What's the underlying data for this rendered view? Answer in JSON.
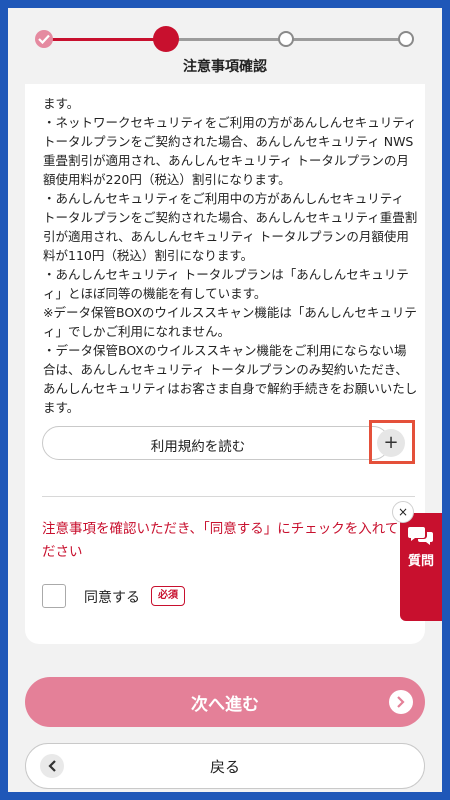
{
  "stepper": {
    "title": "注意事項確認",
    "active_color": "#c8102e"
  },
  "notes": {
    "lines": [
      "ます。",
      "・ネットワークセキュリティをご利用の方があんしんセキュリティ トータルプランをご契約された場合、あんしんセキュリティ NWS重畳割引が適用され、あんしんセキュリティ トータルプランの月額使用料が220円（税込）割引になります。",
      "・あんしんセキュリティをご利用中の方があんしんセキュリティ トータルプランをご契約された場合、あんしんセキュリティ重畳割引が適用され、あんしんセキュリティ トータルプランの月額使用料が110円（税込）割引になります。",
      "・あんしんセキュリティ トータルプランは「あんしんセキュリティ」とほぼ同等の機能を有しています。",
      "※データ保管BOXのウイルススキャン機能は「あんしんセキュリティ」でしかご利用になれません。",
      "・データ保管BOXのウイルススキャン機能をご利用にならない場合は、あんしんセキュリティ トータルプランのみ契約いただき、あんしんセキュリティはお客さま自身で解約手続きをお願いいたします。"
    ]
  },
  "terms": {
    "label": "利用規約を読む",
    "icon": "+"
  },
  "warning": "注意事項を確認いただき、「同意する」にチェックを入れてください",
  "agree": {
    "label": "同意する",
    "badge": "必須",
    "checked": false
  },
  "question_tab": {
    "label": "質問",
    "close": "×"
  },
  "buttons": {
    "next": "次へ進む",
    "back": "戻る"
  }
}
